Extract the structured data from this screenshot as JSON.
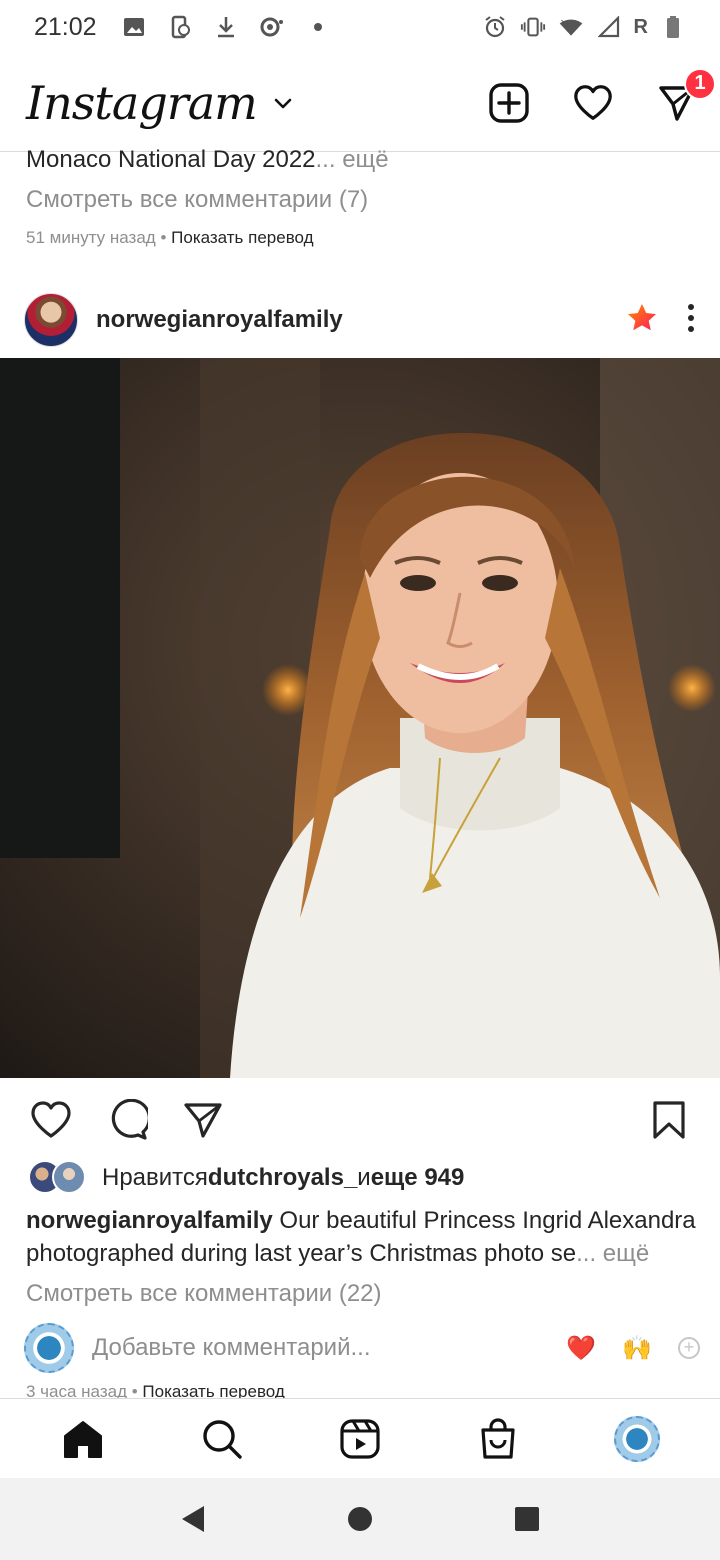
{
  "status_bar": {
    "time": "21:02",
    "network_letter": "R"
  },
  "header": {
    "logo": "Instagram",
    "messages_badge": "1"
  },
  "previous_post": {
    "caption_text": "Monaco National Day 2022",
    "caption_more": "... ещё",
    "view_comments": "Смотреть все комментарии (7)",
    "time_ago": "51 минуту назад",
    "separator": " • ",
    "translate": "Показать перевод"
  },
  "post": {
    "username": "norwegianroyalfamily",
    "likes": {
      "prefix": "Нравится ",
      "user": "dutchroyals_",
      "middle": " и ",
      "count": "еще 949"
    },
    "caption": {
      "username": "norwegianroyalfamily",
      "text": " Our beautiful Princess Ingrid Alexandra photographed during last year’s Christmas photo se",
      "more": "... ещё"
    },
    "view_comments": "Смотреть все комментарии (22)",
    "comment_placeholder": "Добавьте комментарий...",
    "quick_reactions": [
      "❤️",
      "🙌"
    ],
    "time_ago": "3 часа назад",
    "separator": " • ",
    "translate": "Показать перевод"
  },
  "colors": {
    "accent_red": "#ff3040",
    "text": "#262626",
    "muted": "#8e8e8e",
    "border": "#dbdbdb"
  }
}
